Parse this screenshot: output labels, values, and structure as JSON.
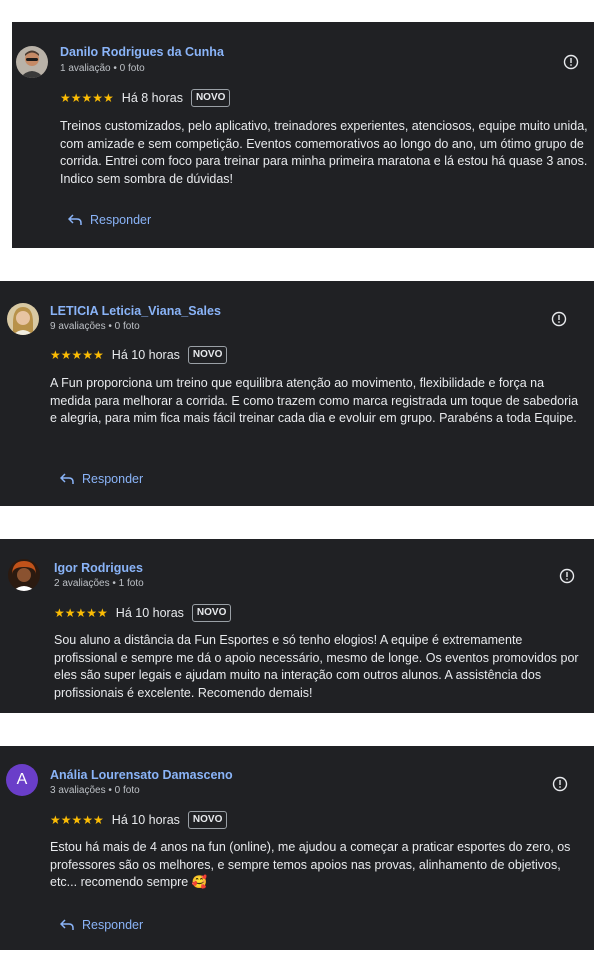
{
  "colors": {
    "card_bg": "#202124",
    "name": "#8ab4f8",
    "star": "#fbbc04",
    "link": "#8ab4f8"
  },
  "reviews": [
    {
      "author": "Danilo Rodrigues da Cunha",
      "meta": "1 avaliação • 0 foto",
      "stars": "★★★★★",
      "rating": 5,
      "time": "Há 8 horas",
      "badge": "NOVO",
      "text": "Treinos customizados, pelo aplicativo, treinadores experientes, atenciosos, equipe muito unida, com amizade e sem competição. Eventos comemorativos ao longo do ano, um ótimo grupo de corrida. Entrei com foco para treinar para minha primeira maratona e lá estou há quase 3 anos. Indico sem sombra de dúvidas!",
      "reply_label": "Responder",
      "avatar_icon": "profile-photo"
    },
    {
      "author": "LETICIA Leticia_Viana_Sales",
      "meta": "9 avaliações • 0 foto",
      "stars": "★★★★★",
      "rating": 5,
      "time": "Há 10 horas",
      "badge": "NOVO",
      "text": "A Fun proporciona um treino que equilibra atenção ao movimento, flexibilidade e força na medida para melhorar a corrida. E como trazem como marca registrada um toque de sabedoria e alegria, para mim fica mais fácil treinar cada dia e evoluir em grupo. Parabéns a toda Equipe.",
      "reply_label": "Responder",
      "avatar_icon": "profile-photo"
    },
    {
      "author": "Igor Rodrigues",
      "meta": "2 avaliações • 1 foto",
      "stars": "★★★★★",
      "rating": 5,
      "time": "Há 10 horas",
      "badge": "NOVO",
      "text": "Sou aluno a distância da Fun Esportes e só tenho elogios! A equipe é extremamente profissional e sempre me dá o apoio necessário, mesmo de longe. Os eventos promovidos por eles são super legais e ajudam muito na interação com outros alunos. A assistência dos profissionais é excelente. Recomendo demais!",
      "avatar_icon": "profile-photo"
    },
    {
      "author": "Anália Lourensato Damasceno",
      "meta": "3 avaliações • 0 foto",
      "stars": "★★★★★",
      "rating": 5,
      "time": "Há 10 horas",
      "badge": "NOVO",
      "text": "Estou há mais de 4 anos na fun (online), me ajudou a começar a praticar esportes do zero, os professores são os melhores, e sempre temos apoios nas provas, alinhamento de objetivos, etc... recomendo sempre 🥰",
      "reply_label": "Responder",
      "avatar_letter": "A",
      "avatar_color": "#6a3ec9"
    }
  ]
}
